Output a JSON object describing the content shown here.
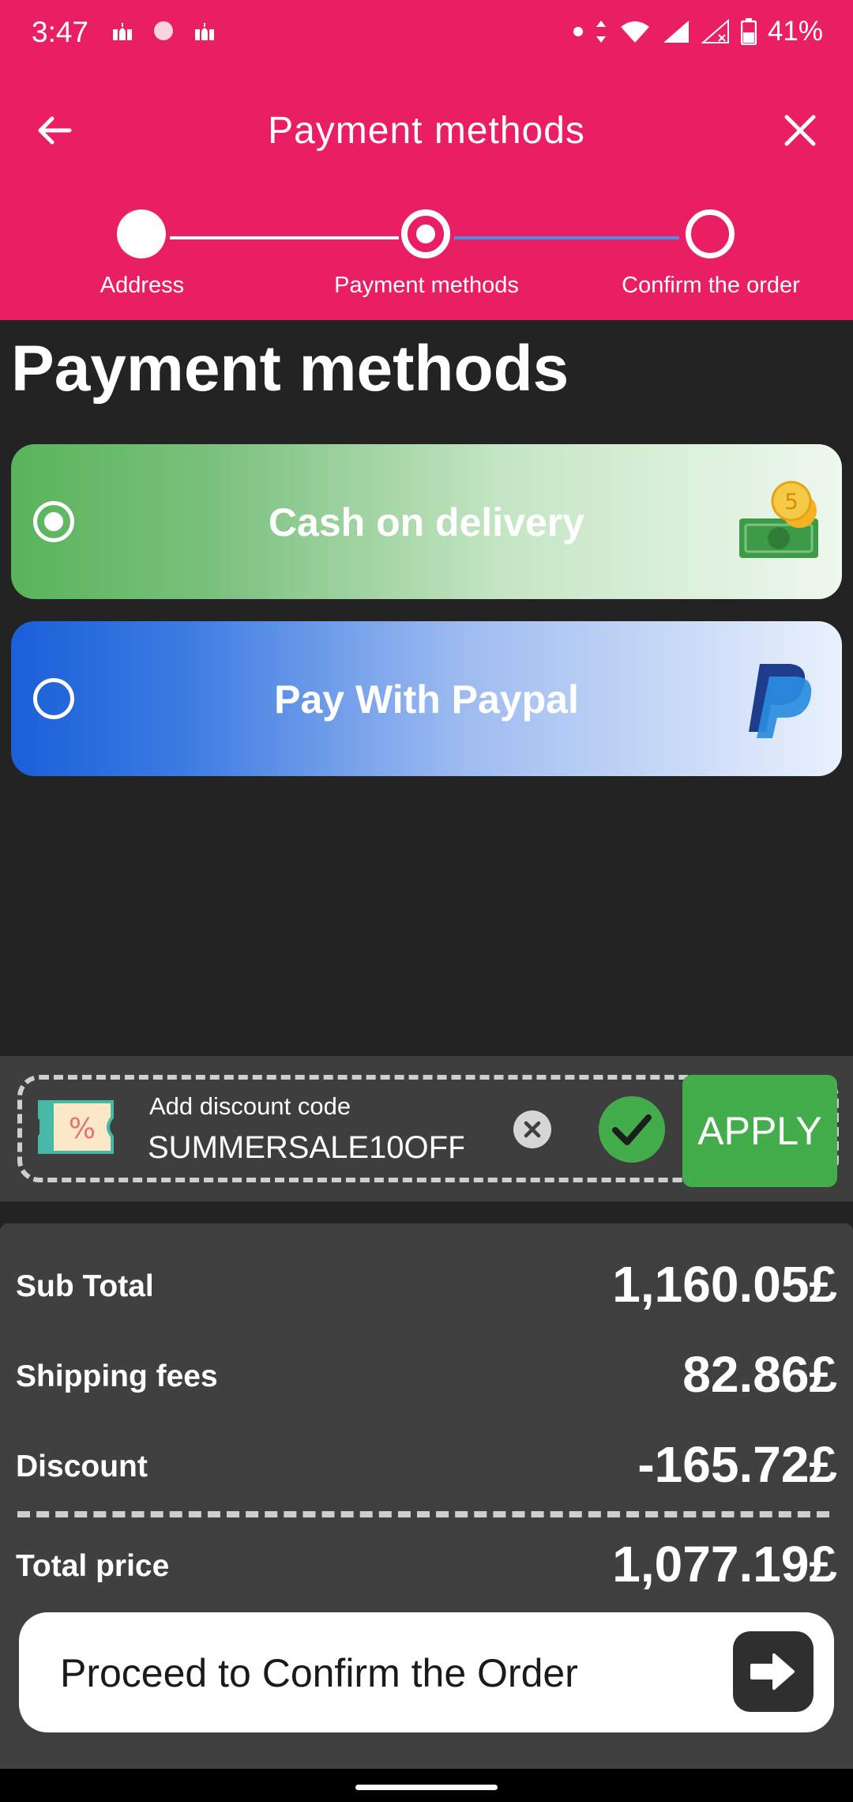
{
  "status_bar": {
    "time": "3:47",
    "battery": "41%",
    "icons": [
      "mosque-icon",
      "circle-icon",
      "mosque-icon",
      "dot-icon",
      "data-arrows-icon",
      "wifi-icon",
      "signal-icon",
      "signal-off-icon",
      "battery-icon"
    ]
  },
  "toolbar": {
    "title": "Payment methods",
    "back_icon": "back-arrow-icon",
    "close_icon": "close-icon"
  },
  "stepper": {
    "steps": [
      {
        "label": "Address",
        "state": "completed"
      },
      {
        "label": "Payment methods",
        "state": "current"
      },
      {
        "label": "Confirm the order",
        "state": "pending"
      }
    ]
  },
  "main": {
    "heading": "Payment methods",
    "methods": [
      {
        "label": "Cash on delivery",
        "selected": true,
        "icon": "cash-coins-icon",
        "color": "#58b45a"
      },
      {
        "label": "Pay With Paypal",
        "selected": false,
        "icon": "paypal-icon",
        "color": "#1a5fd8"
      }
    ]
  },
  "discount": {
    "label": "Add discount code",
    "value": "SUMMERSALE10OFF",
    "apply_label": "APPLY",
    "apply_color": "#43ad4b"
  },
  "summary": {
    "rows": [
      {
        "label": "Sub Total",
        "value": "1,160.05£"
      },
      {
        "label": "Shipping fees",
        "value": "82.86£"
      },
      {
        "label": "Discount",
        "value": "-165.72£"
      },
      {
        "label": "Total price",
        "value": "1,077.19£"
      }
    ]
  },
  "proceed": {
    "label": "Proceed to Confirm the Order"
  },
  "colors": {
    "brand": "#ea1e63",
    "background": "#232323",
    "stepper_active_line": "#4a90e2"
  }
}
